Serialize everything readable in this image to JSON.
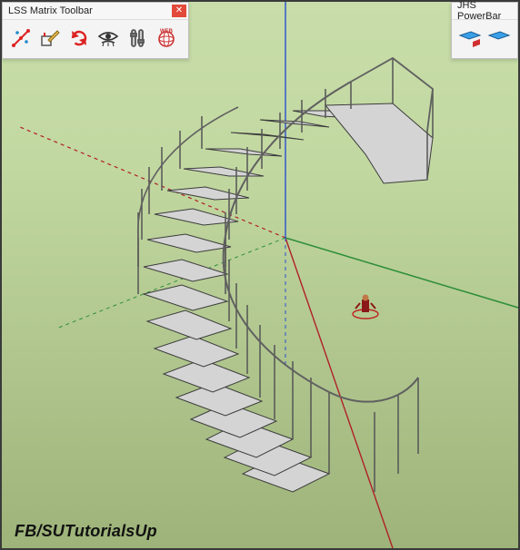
{
  "toolbars": {
    "left": {
      "title": "LSS Matrix Toolbar",
      "close": "✕",
      "tools": [
        {
          "name": "mesh-points-icon"
        },
        {
          "name": "edit-mesh-icon"
        },
        {
          "name": "refresh-icon"
        },
        {
          "name": "visibility-icon"
        },
        {
          "name": "settings-sliders-icon"
        },
        {
          "name": "web-globe-icon"
        }
      ]
    },
    "right": {
      "title": "JHS PowerBar",
      "tools": [
        {
          "name": "face-front-icon"
        },
        {
          "name": "face-back-icon"
        }
      ]
    }
  },
  "scene": {
    "object": "spiral-staircase",
    "axes": [
      "red",
      "green",
      "blue"
    ],
    "origin_marker": "person-figure"
  },
  "watermark": "FB/SUTutorialsUp"
}
